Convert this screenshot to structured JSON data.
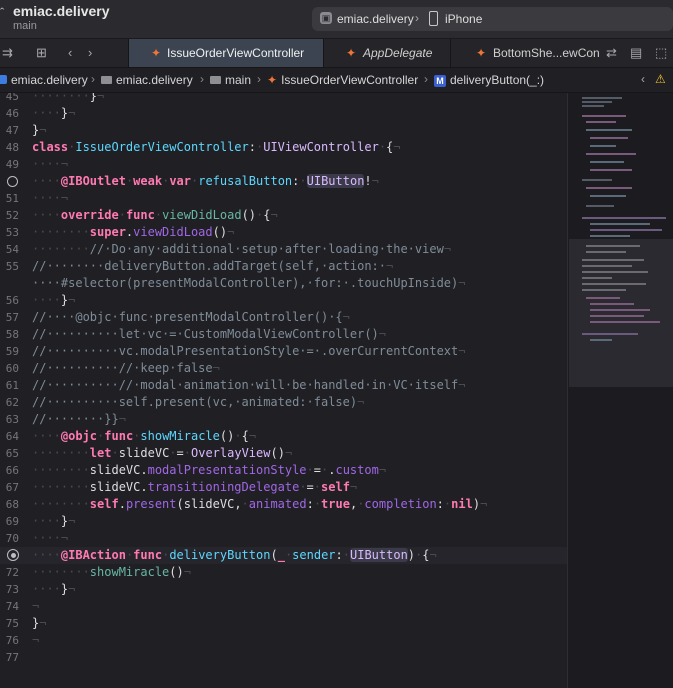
{
  "window": {
    "project_name": "emiac.delivery",
    "branch": "main",
    "scheme": "emiac.delivery",
    "device": "iPhone"
  },
  "tabs": [
    {
      "label": "IssueOrderViewController",
      "active": true
    },
    {
      "label": "AppDelegate",
      "active": false
    },
    {
      "label": "BottomShe...ewCon",
      "active": false
    }
  ],
  "jumpbar": {
    "items": [
      "emiac.delivery",
      "emiac.delivery",
      "main",
      "IssueOrderViewController",
      "deliveryButton(_:)"
    ],
    "method_badge": "M"
  },
  "editor": {
    "lines": [
      {
        "n": "45"
      },
      {
        "n": "46"
      },
      {
        "n": "47"
      },
      {
        "n": "48"
      },
      {
        "n": "49"
      },
      {
        "n": "50"
      },
      {
        "n": "51"
      },
      {
        "n": "52"
      },
      {
        "n": "53"
      },
      {
        "n": "54"
      },
      {
        "n": "55"
      },
      {
        "n": ""
      },
      {
        "n": "56"
      },
      {
        "n": "57"
      },
      {
        "n": "58"
      },
      {
        "n": "59"
      },
      {
        "n": "60"
      },
      {
        "n": "61"
      },
      {
        "n": "62"
      },
      {
        "n": "63"
      },
      {
        "n": "64"
      },
      {
        "n": "65"
      },
      {
        "n": "66"
      },
      {
        "n": "67"
      },
      {
        "n": "68"
      },
      {
        "n": "69"
      },
      {
        "n": "70"
      },
      {
        "n": "71"
      },
      {
        "n": "72"
      },
      {
        "n": "73"
      },
      {
        "n": "74"
      },
      {
        "n": "75"
      },
      {
        "n": "76"
      },
      {
        "n": "77"
      }
    ],
    "colors": {
      "keyword": "#ff7ab2",
      "type": "#dabaff",
      "comment": "#7f8c98",
      "attribute": "#fd8f3f"
    }
  }
}
